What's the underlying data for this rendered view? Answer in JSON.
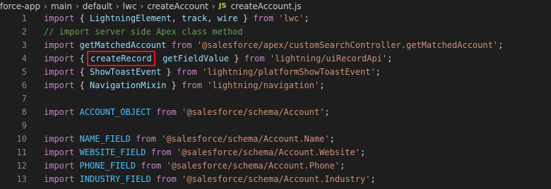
{
  "breadcrumb": {
    "items": [
      "force-app",
      "main",
      "default",
      "lwc",
      "createAccount"
    ],
    "file_icon": "JS",
    "file": "createAccount.js"
  },
  "colors": {
    "background": "#1e1e1e",
    "keyword": "#c586c0",
    "string": "#ce9178",
    "variable": "#9cdcfe",
    "constant": "#4fc1ff",
    "comment": "#6a9955",
    "highlight_box": "#e81123"
  },
  "icons": {
    "separator": "chevron-right-icon",
    "file_type": "javascript-file-icon"
  },
  "code": {
    "lines": [
      {
        "n": "1",
        "t": [
          {
            "c": "kw",
            "v": "import"
          },
          {
            "c": "pun",
            "v": " { "
          },
          {
            "c": "var",
            "v": "LightningElement"
          },
          {
            "c": "pun",
            "v": ", "
          },
          {
            "c": "var",
            "v": "track"
          },
          {
            "c": "pun",
            "v": ", "
          },
          {
            "c": "var",
            "v": "wire"
          },
          {
            "c": "pun",
            "v": " } "
          },
          {
            "c": "kw",
            "v": "from"
          },
          {
            "c": "pun",
            "v": " "
          },
          {
            "c": "str",
            "v": "'lwc'"
          },
          {
            "c": "pun",
            "v": ";"
          }
        ]
      },
      {
        "n": "2",
        "t": [
          {
            "c": "cmt",
            "v": "// import server side Apex class method"
          }
        ]
      },
      {
        "n": "3",
        "t": [
          {
            "c": "kw",
            "v": "import"
          },
          {
            "c": "pun",
            "v": " "
          },
          {
            "c": "var",
            "v": "getMatchedAccount"
          },
          {
            "c": "pun",
            "v": " "
          },
          {
            "c": "kw",
            "v": "from"
          },
          {
            "c": "pun",
            "v": " "
          },
          {
            "c": "str",
            "v": "'@salesforce/apex/customSearchController.getMatchedAccount'"
          },
          {
            "c": "pun",
            "v": ";"
          }
        ]
      },
      {
        "n": "4",
        "t": [
          {
            "c": "kw",
            "v": "import"
          },
          {
            "c": "pun",
            "v": " { "
          },
          {
            "c": "var hl",
            "v": "createRecord"
          },
          {
            "c": "pun",
            "v": ", "
          },
          {
            "c": "var",
            "v": "getFieldValue"
          },
          {
            "c": "pun",
            "v": " } "
          },
          {
            "c": "kw",
            "v": "from"
          },
          {
            "c": "pun",
            "v": " "
          },
          {
            "c": "str",
            "v": "'lightning/uiRecordApi'"
          },
          {
            "c": "pun",
            "v": ";"
          }
        ]
      },
      {
        "n": "5",
        "t": [
          {
            "c": "kw",
            "v": "import"
          },
          {
            "c": "pun",
            "v": " { "
          },
          {
            "c": "var",
            "v": "ShowToastEvent"
          },
          {
            "c": "pun",
            "v": " } "
          },
          {
            "c": "kw",
            "v": "from"
          },
          {
            "c": "pun",
            "v": " "
          },
          {
            "c": "str",
            "v": "'lightning/platformShowToastEvent'"
          },
          {
            "c": "pun",
            "v": ";"
          }
        ]
      },
      {
        "n": "6",
        "t": [
          {
            "c": "kw",
            "v": "import"
          },
          {
            "c": "pun",
            "v": " { "
          },
          {
            "c": "var",
            "v": "NavigationMixin"
          },
          {
            "c": "pun",
            "v": " } "
          },
          {
            "c": "kw",
            "v": "from"
          },
          {
            "c": "pun",
            "v": " "
          },
          {
            "c": "str",
            "v": "'lightning/navigation'"
          },
          {
            "c": "pun",
            "v": ";"
          }
        ]
      },
      {
        "n": "7",
        "t": []
      },
      {
        "n": "8",
        "t": [
          {
            "c": "kw",
            "v": "import"
          },
          {
            "c": "pun",
            "v": " "
          },
          {
            "c": "cnst",
            "v": "ACCOUNT_OBJECT"
          },
          {
            "c": "pun",
            "v": " "
          },
          {
            "c": "kw",
            "v": "from"
          },
          {
            "c": "pun",
            "v": " "
          },
          {
            "c": "str",
            "v": "'@salesforce/schema/Account'"
          },
          {
            "c": "pun",
            "v": ";"
          }
        ]
      },
      {
        "n": "9",
        "t": []
      },
      {
        "n": "10",
        "t": [
          {
            "c": "kw",
            "v": "import"
          },
          {
            "c": "pun",
            "v": " "
          },
          {
            "c": "cnst",
            "v": "NAME_FIELD"
          },
          {
            "c": "pun",
            "v": " "
          },
          {
            "c": "kw",
            "v": "from"
          },
          {
            "c": "pun",
            "v": " "
          },
          {
            "c": "str",
            "v": "'@salesforce/schema/Account.Name'"
          },
          {
            "c": "pun",
            "v": ";"
          }
        ]
      },
      {
        "n": "11",
        "t": [
          {
            "c": "kw",
            "v": "import"
          },
          {
            "c": "pun",
            "v": " "
          },
          {
            "c": "cnst",
            "v": "WEBSITE_FIELD"
          },
          {
            "c": "pun",
            "v": " "
          },
          {
            "c": "kw",
            "v": "from"
          },
          {
            "c": "pun",
            "v": " "
          },
          {
            "c": "str",
            "v": "'@salesforce/schema/Account.Website'"
          },
          {
            "c": "pun",
            "v": ";"
          }
        ]
      },
      {
        "n": "12",
        "t": [
          {
            "c": "kw",
            "v": "import"
          },
          {
            "c": "pun",
            "v": " "
          },
          {
            "c": "cnst",
            "v": "PHONE_FIELD"
          },
          {
            "c": "pun",
            "v": " "
          },
          {
            "c": "kw",
            "v": "from"
          },
          {
            "c": "pun",
            "v": " "
          },
          {
            "c": "str",
            "v": "'@salesforce/schema/Account.Phone'"
          },
          {
            "c": "pun",
            "v": ";"
          }
        ]
      },
      {
        "n": "13",
        "t": [
          {
            "c": "kw",
            "v": "import"
          },
          {
            "c": "pun",
            "v": " "
          },
          {
            "c": "cnst",
            "v": "INDUSTRY_FIELD"
          },
          {
            "c": "pun",
            "v": " "
          },
          {
            "c": "kw",
            "v": "from"
          },
          {
            "c": "pun",
            "v": " "
          },
          {
            "c": "str",
            "v": "'@salesforce/schema/Account.Industry'"
          },
          {
            "c": "pun",
            "v": ";"
          }
        ]
      }
    ]
  }
}
